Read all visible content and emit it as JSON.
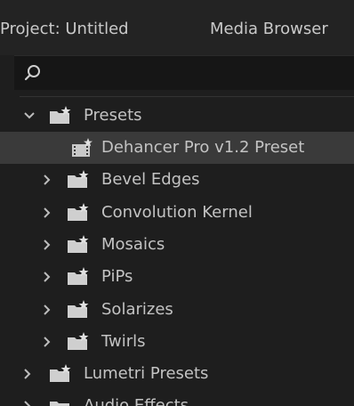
{
  "tabs": {
    "project": "Project: Untitled",
    "media_browser": "Media Browser"
  },
  "search": {
    "value": "",
    "placeholder": ""
  },
  "tree": {
    "items": [
      {
        "label": "Presets",
        "expanded": true,
        "icon": "preset-folder-icon"
      },
      {
        "label": "Dehancer Pro v1.2 Preset",
        "icon": "preset-clip-icon",
        "selected": true
      },
      {
        "label": "Bevel Edges",
        "expanded": false,
        "icon": "preset-folder-icon"
      },
      {
        "label": "Convolution Kernel",
        "expanded": false,
        "icon": "preset-folder-icon"
      },
      {
        "label": "Mosaics",
        "expanded": false,
        "icon": "preset-folder-icon"
      },
      {
        "label": "PiPs",
        "expanded": false,
        "icon": "preset-folder-icon"
      },
      {
        "label": "Solarizes",
        "expanded": false,
        "icon": "preset-folder-icon"
      },
      {
        "label": "Twirls",
        "expanded": false,
        "icon": "preset-folder-icon"
      },
      {
        "label": "Lumetri Presets",
        "expanded": false,
        "icon": "preset-folder-icon"
      },
      {
        "label": "Audio Effects",
        "expanded": false,
        "icon": "folder-icon"
      }
    ]
  },
  "colors": {
    "background": "#1e1e1e",
    "selected_row": "#3a3a3a",
    "text": "#c3c3c3"
  }
}
